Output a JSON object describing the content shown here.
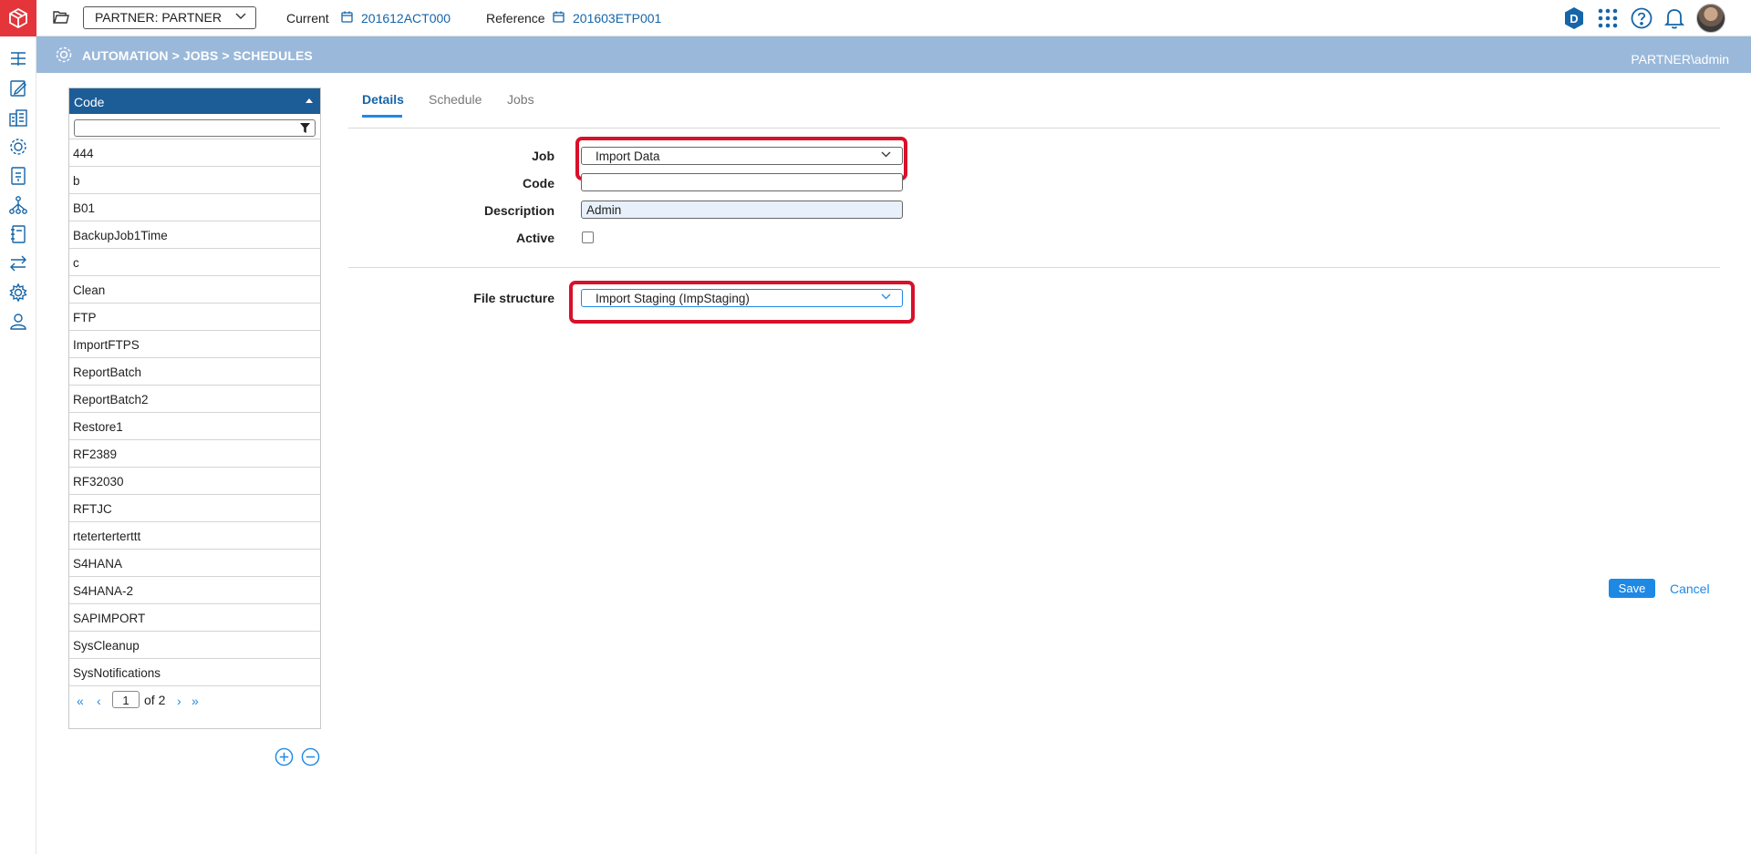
{
  "topbar": {
    "partner_select": "PARTNER: PARTNER",
    "current_label": "Current",
    "current_value": "201612ACT000",
    "reference_label": "Reference",
    "reference_value": "201603ETP001",
    "badge_letter": "D"
  },
  "header": {
    "breadcrumb": "AUTOMATION > JOBS > SCHEDULES",
    "user": "PARTNER\\admin"
  },
  "list": {
    "column": "Code",
    "items": [
      "444",
      "b",
      "B01",
      "BackupJob1Time",
      "c",
      "Clean",
      "FTP",
      "ImportFTPS",
      "ReportBatch",
      "ReportBatch2",
      "Restore1",
      "RF2389",
      "RF32030",
      "RFTJC",
      "rteterterterttt",
      "S4HANA",
      "S4HANA-2",
      "SAPIMPORT",
      "SysCleanup",
      "SysNotifications"
    ],
    "page": "1",
    "of_label": "of",
    "total_pages": "2"
  },
  "tabs": [
    "Details",
    "Schedule",
    "Jobs"
  ],
  "form": {
    "job_label": "Job",
    "job_value": "Import Data",
    "code_label": "Code",
    "code_value": "",
    "description_label": "Description",
    "description_value": "Admin",
    "active_label": "Active",
    "active_checked": false,
    "file_structure_label": "File structure",
    "file_structure_value": "Import Staging (ImpStaging)"
  },
  "actions": {
    "save": "Save",
    "cancel": "Cancel"
  },
  "colors": {
    "brand": "#e4353b",
    "header_band": "#9ab8da",
    "list_header": "#1d5d97",
    "accent": "#1e88e5",
    "highlight": "#d9102a"
  }
}
